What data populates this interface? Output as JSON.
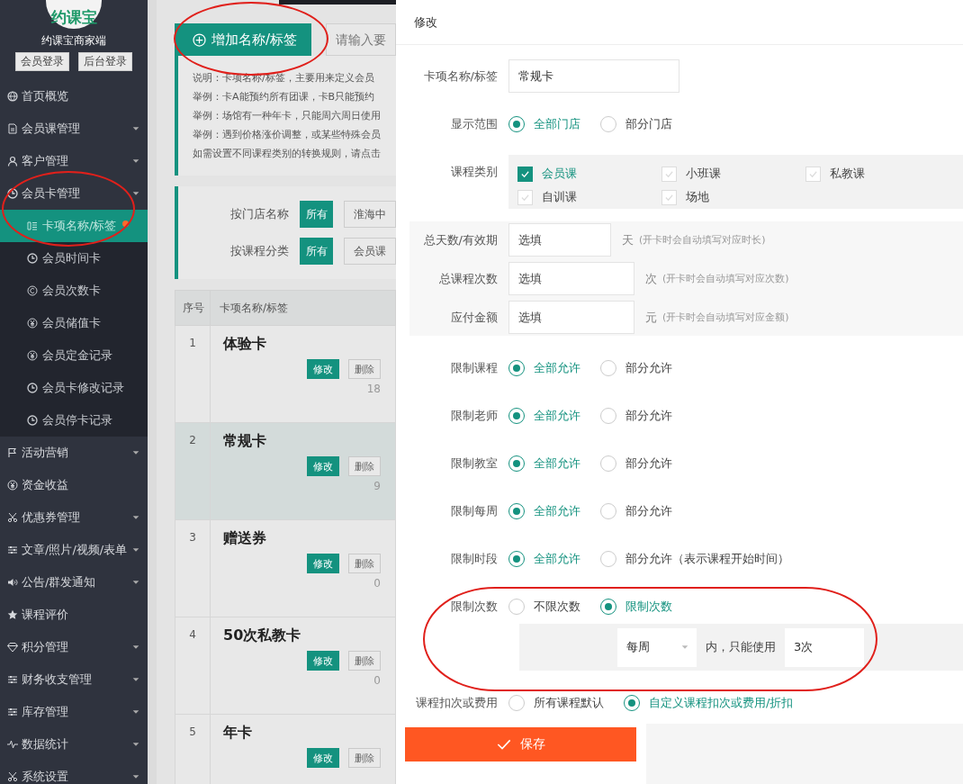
{
  "sidebar": {
    "logo_text": "约课宝",
    "brand": "约课宝商家端",
    "login_buttons": [
      "会员登录",
      "后台登录"
    ],
    "items": [
      {
        "label": "首页概览",
        "expandable": false
      },
      {
        "label": "会员课管理",
        "expandable": true
      },
      {
        "label": "客户管理",
        "expandable": true
      },
      {
        "label": "会员卡管理",
        "expandable": true,
        "expanded": true,
        "children": [
          {
            "label": "卡项名称/标签",
            "selected": true
          },
          {
            "label": "会员时间卡",
            "selected": false
          },
          {
            "label": "会员次数卡",
            "selected": false
          },
          {
            "label": "会员储值卡",
            "selected": false
          },
          {
            "label": "会员定金记录",
            "selected": false
          },
          {
            "label": "会员卡修改记录",
            "selected": false
          },
          {
            "label": "会员停卡记录",
            "selected": false
          }
        ]
      },
      {
        "label": "活动营销",
        "expandable": true
      },
      {
        "label": "资金收益",
        "expandable": false
      },
      {
        "label": "优惠券管理",
        "expandable": true
      },
      {
        "label": "文章/照片/视频/表单",
        "expandable": true
      },
      {
        "label": "公告/群发通知",
        "expandable": true
      },
      {
        "label": "课程评价",
        "expandable": false
      },
      {
        "label": "积分管理",
        "expandable": true
      },
      {
        "label": "财务收支管理",
        "expandable": true
      },
      {
        "label": "库存管理",
        "expandable": true
      },
      {
        "label": "数据统计",
        "expandable": true
      },
      {
        "label": "系统设置",
        "expandable": true
      }
    ]
  },
  "main": {
    "add_button": "增加名称/标签",
    "search": {
      "placeholder": "请输入要"
    },
    "notes": [
      "说明：卡项名称/标签，主要用来定义会员",
      "举例：卡A能预约所有团课，卡B只能预约",
      "举例：场馆有一种年卡，只能周六周日使用",
      "举例：遇到价格涨价调整，或某些特殊会员",
      "如需设置不同课程类别的转换规则，请点击"
    ],
    "filters": [
      {
        "label": "按门店名称",
        "all": "所有",
        "option": "淮海中"
      },
      {
        "label": "按课程分类",
        "all": "所有",
        "option": "会员课"
      }
    ],
    "table": {
      "columns": [
        "序号",
        "卡项名称/标签"
      ],
      "rows": [
        {
          "index": "1",
          "name": "体验卡",
          "edit": "修改",
          "delete": "删除",
          "count": "18",
          "selected": false
        },
        {
          "index": "2",
          "name": "常规卡",
          "edit": "修改",
          "delete": "删除",
          "count": "9",
          "selected": true
        },
        {
          "index": "3",
          "name": "赠送券",
          "edit": "修改",
          "delete": "删除",
          "count": "0",
          "selected": false
        },
        {
          "index": "4",
          "name": "50次私教卡",
          "edit": "修改",
          "delete": "删除",
          "count": "0",
          "selected": false
        },
        {
          "index": "5",
          "name": "年卡",
          "edit": "修改",
          "delete": "删除",
          "selected": false
        }
      ]
    }
  },
  "modal": {
    "title": "修改",
    "name_field": {
      "label": "卡项名称/标签",
      "value": "常规卡"
    },
    "scope": {
      "label": "显示范围",
      "options": [
        {
          "label": "全部门店",
          "selected": true
        },
        {
          "label": "部分门店",
          "selected": false
        }
      ]
    },
    "categories": {
      "label": "课程类别",
      "items": [
        {
          "label": "会员课",
          "checked": true
        },
        {
          "label": "小班课",
          "checked": false
        },
        {
          "label": "私教课",
          "checked": false
        },
        {
          "label": "自训课",
          "checked": false
        },
        {
          "label": "场地",
          "checked": false
        }
      ]
    },
    "amount_fields": [
      {
        "label": "总天数/有效期",
        "placeholder": "选填",
        "unit": "天",
        "hint": "(开卡时会自动填写对应时长)"
      },
      {
        "label": "总课程次数",
        "placeholder": "选填",
        "unit": "次",
        "hint": "(开卡时会自动填写对应次数)"
      },
      {
        "label": "应付金额",
        "placeholder": "选填",
        "unit": "元",
        "hint": "(开卡时会自动填写对应金额)"
      }
    ],
    "limits": [
      {
        "label": "限制课程",
        "options": [
          {
            "label": "全部允许",
            "selected": true
          },
          {
            "label": "部分允许",
            "selected": false
          }
        ]
      },
      {
        "label": "限制老师",
        "options": [
          {
            "label": "全部允许",
            "selected": true
          },
          {
            "label": "部分允许",
            "selected": false
          }
        ]
      },
      {
        "label": "限制教室",
        "options": [
          {
            "label": "全部允许",
            "selected": true
          },
          {
            "label": "部分允许",
            "selected": false
          }
        ]
      },
      {
        "label": "限制每周",
        "options": [
          {
            "label": "全部允许",
            "selected": true
          },
          {
            "label": "部分允许",
            "selected": false
          }
        ]
      },
      {
        "label": "限制时段",
        "options": [
          {
            "label": "全部允许",
            "selected": true
          },
          {
            "label": "部分允许（表示课程开始时间）",
            "selected": false
          }
        ]
      },
      {
        "label": "限制次数",
        "options": [
          {
            "label": "不限次数",
            "selected": false
          },
          {
            "label": "限制次数",
            "selected": true
          }
        ]
      }
    ],
    "count_limit": {
      "period": "每周",
      "text": "内，只能使用",
      "value": "3次"
    },
    "deduction": {
      "label": "课程扣次或费用",
      "options": [
        {
          "label": "所有课程默认",
          "selected": false
        },
        {
          "label": "自定义课程扣次或费用/折扣",
          "selected": true
        }
      ]
    },
    "save_button": "保存"
  }
}
